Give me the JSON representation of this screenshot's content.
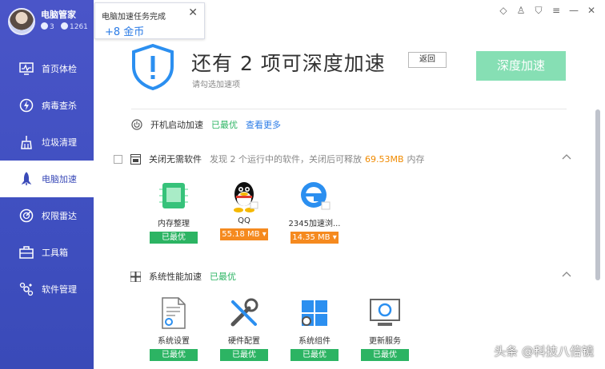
{
  "profile": {
    "name": "电脑管家",
    "stat_a": "3",
    "stat_b": "1261"
  },
  "notification": {
    "title": "电脑加速任务完成",
    "coins": "+8 金币",
    "close": "✕"
  },
  "sidebar": {
    "items": [
      {
        "label": "首页体检",
        "icon": "monitor-icon"
      },
      {
        "label": "病毒查杀",
        "icon": "lightning-icon"
      },
      {
        "label": "垃圾清理",
        "icon": "trash-icon"
      },
      {
        "label": "电脑加速",
        "icon": "rocket-icon",
        "active": true
      },
      {
        "label": "权限雷达",
        "icon": "radar-icon"
      },
      {
        "label": "工具箱",
        "icon": "toolbox-icon"
      },
      {
        "label": "软件管理",
        "icon": "apps-icon"
      }
    ]
  },
  "header": {
    "headline": "还有 2 项可深度加速",
    "subline": "请勾选加速项",
    "back_label": "返回",
    "deep_label": "深度加速"
  },
  "startup": {
    "label": "开机启动加速",
    "status": "已最优",
    "link": "查看更多"
  },
  "software": {
    "label": "关闭无需软件",
    "desc_prefix": "发现 2 个运行中的软件，关闭后可释放",
    "desc_amount": "69.53MB",
    "desc_suffix": "内存",
    "cards": [
      {
        "label": "内存整理",
        "tag": "已最优",
        "tag_color": "#2cb463",
        "icon": "memory-chip-icon"
      },
      {
        "label": "QQ",
        "tag": "55.18 MB ▾",
        "tag_color": "#f58a1f",
        "icon": "qq-icon"
      },
      {
        "label": "2345加速浏...",
        "tag": "14.35 MB ▾",
        "tag_color": "#f58a1f",
        "icon": "browser-e-icon"
      }
    ]
  },
  "system": {
    "label": "系统性能加速",
    "status": "已最优",
    "cards": [
      {
        "label": "系统设置",
        "tag": "已最优",
        "icon": "document-gear-icon"
      },
      {
        "label": "硬件配置",
        "tag": "已最优",
        "icon": "wrench-icon"
      },
      {
        "label": "系统组件",
        "tag": "已最优",
        "icon": "windows-icon"
      },
      {
        "label": "更新服务",
        "tag": "已最优",
        "icon": "refresh-monitor-icon"
      }
    ]
  },
  "watermark": "头条 @科技八倍镜",
  "colors": {
    "accent_green": "#2cb463",
    "sidebar": "#4050c0",
    "deep_button": "#86dfb4",
    "orange": "#f58a1f"
  }
}
